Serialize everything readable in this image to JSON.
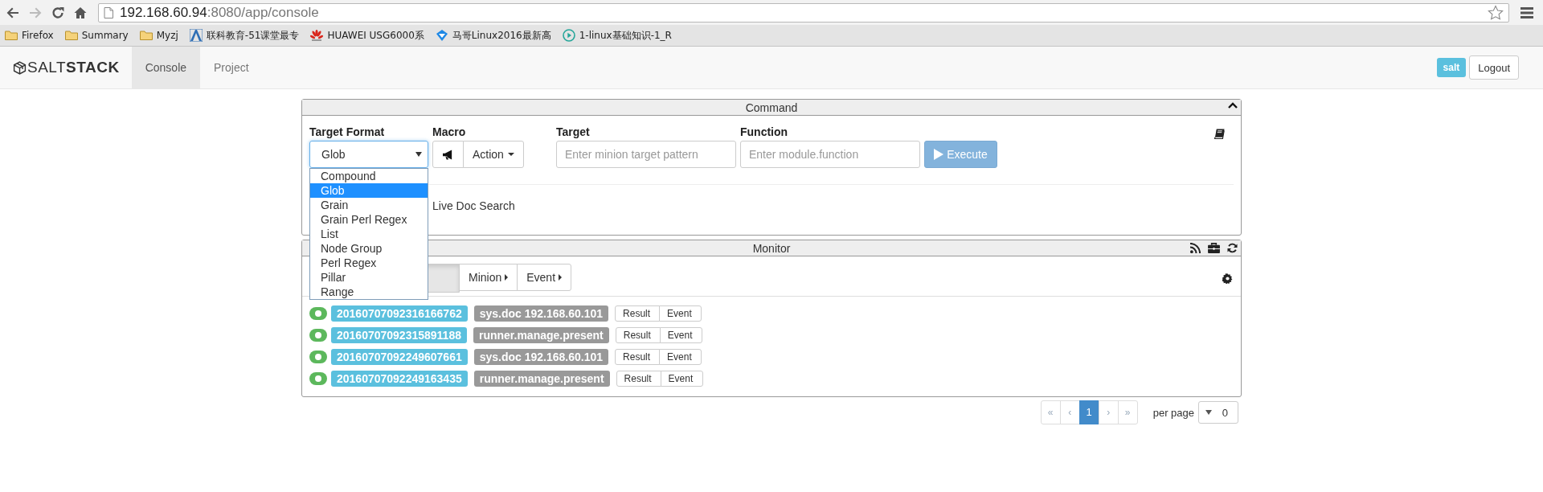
{
  "browser": {
    "url_host": "192.168.60.94",
    "url_path": ":8080/app/console",
    "forward_disabled": true,
    "bookmarks": [
      {
        "kind": "folder",
        "label": "Firefox"
      },
      {
        "kind": "folder",
        "label": "Summary"
      },
      {
        "kind": "folder",
        "label": "Myzj"
      },
      {
        "kind": "peak",
        "label": "联科教育-51课堂最专"
      },
      {
        "kind": "flower",
        "label": "HUAWEI USG6000系"
      },
      {
        "kind": "diamond",
        "label": "马哥Linux2016最新高"
      },
      {
        "kind": "play",
        "label": "1-linux基础知识-1_R"
      }
    ]
  },
  "navbar": {
    "brand": "SALT**STACK**",
    "tabs": [
      {
        "label": "Console",
        "selected": true
      },
      {
        "label": "Project",
        "selected": false
      }
    ],
    "user": "salt",
    "logout": "Logout"
  },
  "command": {
    "title": "Command",
    "target_format": {
      "label": "Target Format",
      "value": "Glob",
      "expanded": true,
      "options": [
        {
          "label": "Compound",
          "selected": false
        },
        {
          "label": "Glob",
          "selected": true
        },
        {
          "label": "Grain",
          "selected": false
        },
        {
          "label": "Grain Perl Regex",
          "selected": false
        },
        {
          "label": "List",
          "selected": false
        },
        {
          "label": "Node Group",
          "selected": false
        },
        {
          "label": "Perl Regex",
          "selected": false
        },
        {
          "label": "Pillar",
          "selected": false
        },
        {
          "label": "Range",
          "selected": false
        }
      ]
    },
    "macro": {
      "label": "Macro",
      "action": "Action"
    },
    "target": {
      "label": "Target",
      "placeholder": "Enter minion target pattern"
    },
    "function": {
      "label": "Function",
      "placeholder": "Enter module.function"
    },
    "execute": {
      "label": "Execute",
      "disabled": true
    },
    "live_doc": "Live Doc Search"
  },
  "monitor": {
    "title": "Monitor",
    "buttons": [
      "Minion",
      "Event"
    ],
    "jobs": [
      {
        "id": "20160707092316166762",
        "function": "sys.doc 192.168.60.101",
        "actions": [
          "Result",
          "Event"
        ]
      },
      {
        "id": "20160707092315891188",
        "function": "runner.manage.present",
        "actions": [
          "Result",
          "Event"
        ]
      },
      {
        "id": "20160707092249607661",
        "function": "sys.doc 192.168.60.101",
        "actions": [
          "Result",
          "Event"
        ]
      },
      {
        "id": "20160707092249163435",
        "function": "runner.manage.present",
        "actions": [
          "Result",
          "Event"
        ]
      }
    ]
  },
  "pagination": {
    "pages": [
      {
        "label": "«",
        "selected": false
      },
      {
        "label": "‹",
        "selected": false
      },
      {
        "label": "1",
        "selected": true
      },
      {
        "label": "›",
        "selected": false
      },
      {
        "label": "»",
        "selected": false
      }
    ],
    "per_page_label": "per page",
    "per_page": "0"
  }
}
